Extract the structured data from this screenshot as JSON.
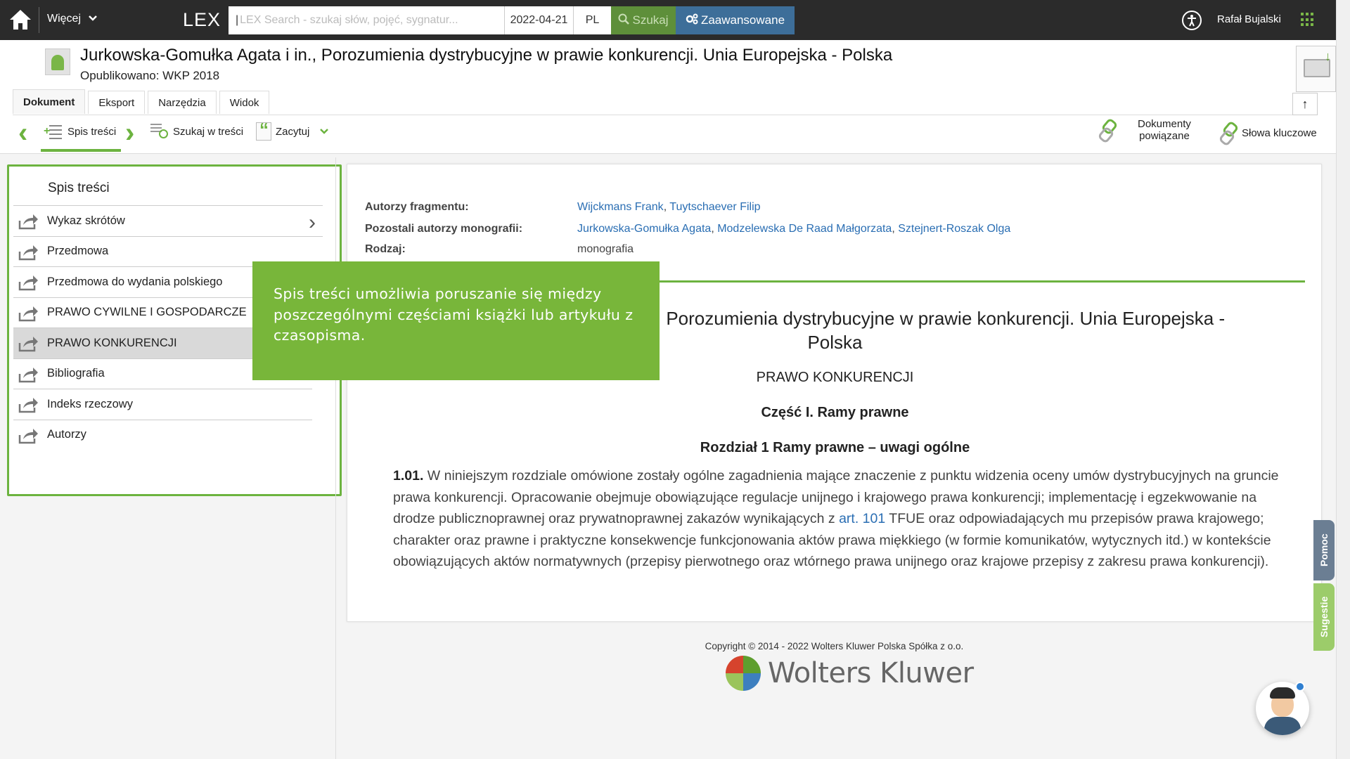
{
  "topbar": {
    "more_label": "Więcej",
    "brand": "LEX",
    "search_placeholder": "LEX Search - szukaj słów, pojęć, sygnatur...",
    "date": "2022-04-21",
    "lang": "PL",
    "search_button": "Szukaj",
    "advanced_button": "Zaawansowane",
    "user_name": "Rafał Bujalski"
  },
  "document": {
    "title": "Jurkowska-Gomułka Agata i in., Porozumienia dystrybucyjne w prawie konkurencji. Unia Europejska - Polska",
    "published": "Opublikowano: WKP 2018"
  },
  "tabs": [
    "Dokument",
    "Eksport",
    "Narzędzia",
    "Widok"
  ],
  "toolbar": {
    "toc": "Spis treści",
    "search_in": "Szukaj w treści",
    "cite": "Zacytuj",
    "related_line1": "Dokumenty",
    "related_line2": "powiązane",
    "keywords": "Słowa kluczowe"
  },
  "sidebar": {
    "title": "Spis treści",
    "items": [
      {
        "label": "Wykaz skrótów"
      },
      {
        "label": "Przedmowa"
      },
      {
        "label": "Przedmowa do wydania polskiego"
      },
      {
        "label": "PRAWO CYWILNE I GOSPODARCZE"
      },
      {
        "label": "PRAWO KONKURENCJI"
      },
      {
        "label": "Bibliografia"
      },
      {
        "label": "Indeks rzeczowy"
      },
      {
        "label": "Autorzy"
      }
    ],
    "active_index": 4
  },
  "tooltip": {
    "text": "Spis treści umożliwia poruszanie się między poszczególnymi częściami książki lub artykułu z czasopisma."
  },
  "meta": {
    "authors_label": "Autorzy fragmentu:",
    "authors": [
      "Wijckmans Frank",
      "Tuytschaever Filip"
    ],
    "other_label": "Pozostali autorzy monografii:",
    "other_authors": [
      "Jurkowska-Gomułka Agata",
      "Modzelewska De Raad Małgorzata",
      "Sztejnert-Roszak Olga"
    ],
    "type_label": "Rodzaj:",
    "type": "monografia"
  },
  "content": {
    "heading_line1": ", Porozumienia dystrybucyjne w prawie konkurencji. Unia Europejska -",
    "heading_line2": "Polska",
    "section": "PRAWO KONKURENCJI",
    "part": "Część I. Ramy prawne",
    "chapter": "Rozdział 1 Ramy prawne – uwagi ogólne",
    "para_num": "1.01.",
    "para_text_a": " W niniejszym rozdziale omówione zostały ogólne zagadnienia mające znaczenie z punktu widzenia oceny umów dystrybucyjnych na gruncie prawa konkurencji. Opracowanie obejmuje obowiązujące regulacje unijnego i krajowego prawa konkurencji; implementację i egzekwowanie na drodze publicznoprawnej oraz prywatnoprawnej zakazów wynikających z ",
    "para_link": "art. 101",
    "para_text_b": " TFUE oraz odpowiadających mu przepisów prawa krajowego; charakter oraz prawne i praktyczne konsekwencje funkcjonowania aktów prawa miękkiego (w formie komunikatów, wytycznych itd.) w kontekście obowiązujących aktów normatywnych (przepisy pierwotnego oraz wtórnego prawa unijnego oraz krajowe przepisy z zakresu prawa konkurencji)."
  },
  "footer": {
    "copyright": "Copyright © 2014 - 2022 Wolters Kluwer Polska Spółka z o.o.",
    "brand": "Wolters Kluwer"
  },
  "side_tabs": {
    "help": "Pomoc",
    "suggestions": "Sugestie"
  },
  "colors": {
    "accent_green": "#6cb33f",
    "topbar": "#2b2b2b",
    "advanced_blue": "#3d6e99",
    "link_blue": "#2a6eb3"
  }
}
